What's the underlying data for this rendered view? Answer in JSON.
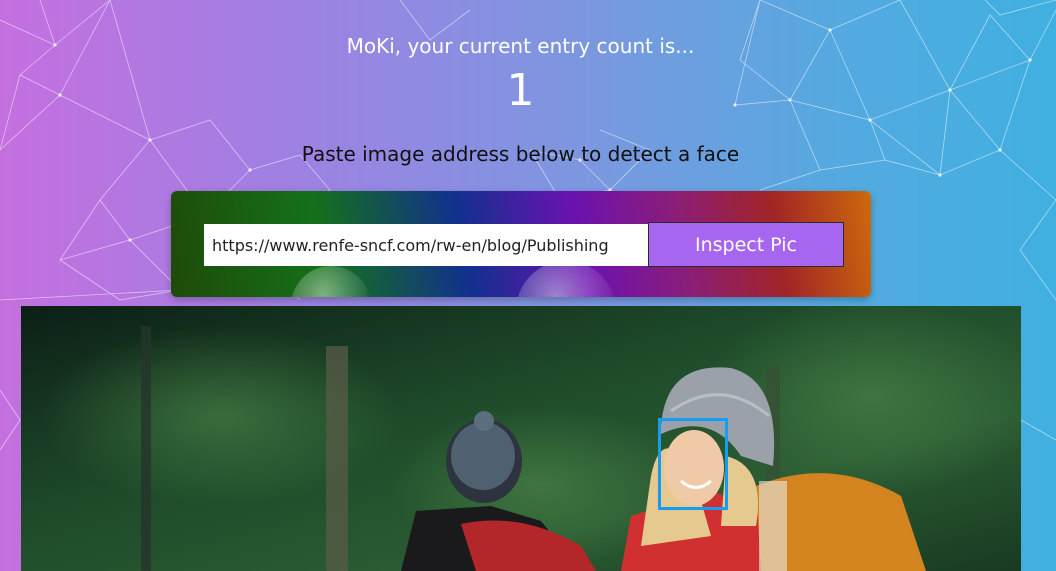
{
  "header": {
    "greeting": "MoKi, your current entry count is...",
    "entry_count": "1",
    "instructions": "Paste image address below to detect a face"
  },
  "form": {
    "url_value": "https://www.renfe-sncf.com/rw-en/blog/Publishing",
    "submit_label": "Inspect Pic"
  },
  "result": {
    "faces_detected": 1
  },
  "colors": {
    "button": "#a766f0",
    "face_box": "#149df2",
    "background_start": "#c56fdf",
    "background_end": "#3fb0e0"
  }
}
